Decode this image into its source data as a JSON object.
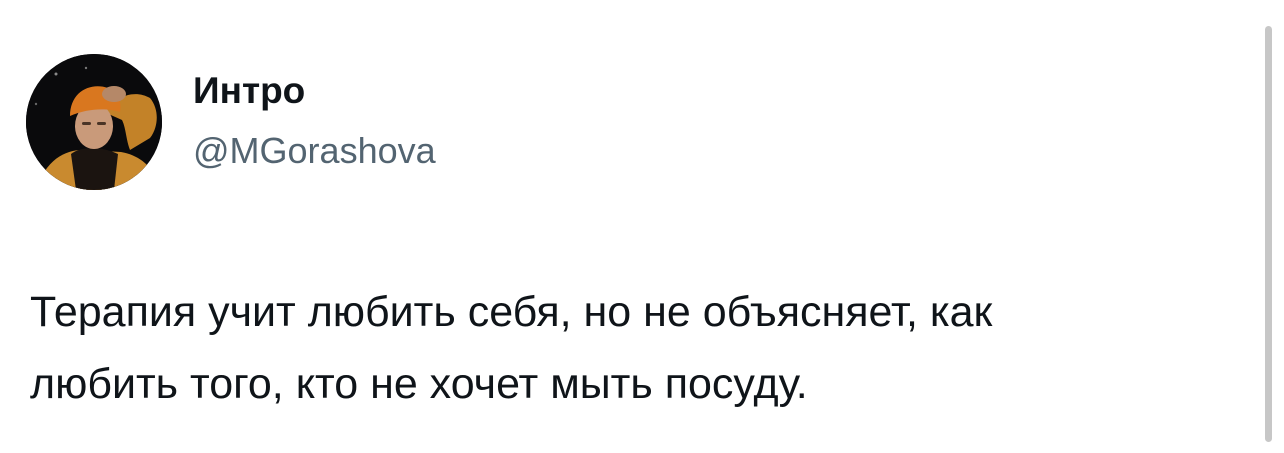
{
  "user": {
    "display_name": "Интро",
    "handle": "@MGorashova",
    "avatar_icon": "profile-photo"
  },
  "tweet": {
    "lines": [
      "Терапия учит любить себя, но не объясняет, как",
      "любить того, кто не хочет мыть посуду."
    ]
  },
  "colors": {
    "text": "#0f1419",
    "secondary_text": "#536471",
    "background": "#ffffff"
  }
}
